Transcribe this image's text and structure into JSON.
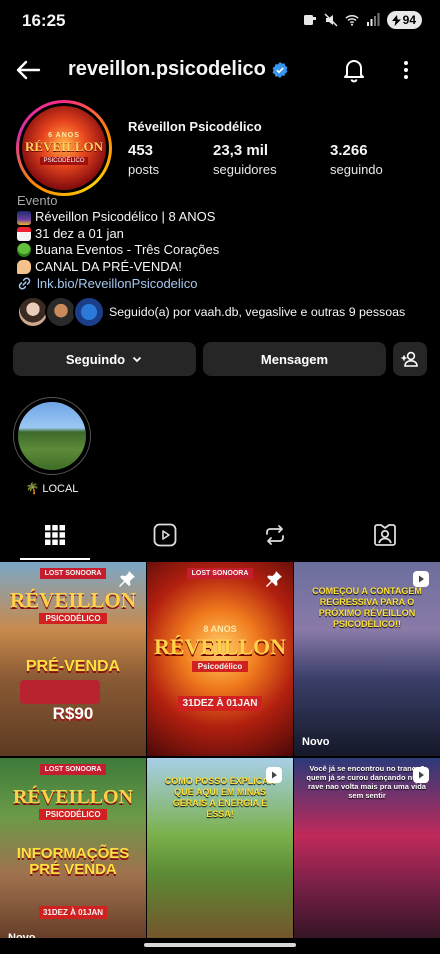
{
  "status": {
    "time": "16:25",
    "battery": "94"
  },
  "header": {
    "username": "reveillon.psicodelico",
    "verified": true
  },
  "avatar": {
    "line1": "6 ANOS",
    "line2": "RÉVEILLON",
    "line3": "PSICODÉLICO"
  },
  "profile": {
    "full_name": "Réveillon Psicodélico",
    "stats": [
      {
        "value": "453",
        "label": "posts"
      },
      {
        "value": "23,3 mil",
        "label": "seguidores"
      },
      {
        "value": "3.266",
        "label": "seguindo"
      }
    ],
    "category": "Evento",
    "bio": [
      {
        "icon": "fireworks-emoji-icon",
        "text": "Réveillon Psicodélico  | 8 ANOS"
      },
      {
        "icon": "calendar-emoji-icon",
        "text": "31 dez a 01 jan"
      },
      {
        "icon": "broccoli-emoji-icon",
        "text": "Buana Eventos - Três Corações"
      },
      {
        "icon": "pointing-finger-emoji-icon",
        "text": "CANAL DA PRÉ-VENDA!"
      }
    ],
    "link": "lnk.bio/ReveillonPsicodelico",
    "followed_by": "Seguido(a) por vaah.db, vegaslive e outras 9 pessoas"
  },
  "buttons": {
    "following": "Seguindo",
    "message": "Mensagem"
  },
  "highlights": [
    {
      "label": "🌴 LOCAL"
    }
  ],
  "posts": [
    {
      "top_label": "LOST SONOORA",
      "title": "RÉVEILLON",
      "subtitle": "PSICODÉLICO",
      "body": "PRÉ-VENDA",
      "extra": "R$90",
      "pinned": true
    },
    {
      "top_label": "LOST SONOORA",
      "title": "RÉVEILLON",
      "subtitle": "Psicodélico",
      "body": "8 ANOS",
      "extra": "31DEZ À 01JAN",
      "pinned": true
    },
    {
      "caption": "COMEÇOU A CONTAGEM REGRESSIVA PARA O PRÓXIMO RÉVEILLON PSICODÉLICO!!",
      "badge": "Novo",
      "reel": true
    },
    {
      "top_label": "LOST SONOORA",
      "title": "RÉVEILLON",
      "subtitle": "PSICODÉLICO",
      "body": "INFORMAÇÕES PRÉ VENDA",
      "extra": "31DEZ À 01JAN",
      "badge": "Novo"
    },
    {
      "caption": "COMO POSSO EXPLICAR QUE AQUI EM MINAS GERAIS A ENERGIA É ESSA!",
      "reel": true
    },
    {
      "caption": "Você já se encontrou no trance? quem já se curou dançando numa rave nao volta mais pra uma vida sem sentir",
      "reel": true
    }
  ],
  "colors": {
    "accent_blue": "#3797f0",
    "button_bg": "#262626",
    "link": "#a7c7ee"
  }
}
